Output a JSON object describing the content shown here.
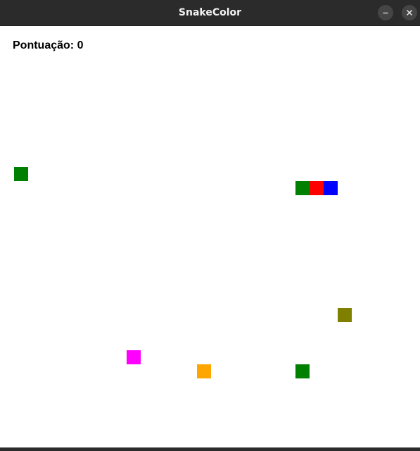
{
  "window": {
    "title": "SnakeColor",
    "minimize_label": "–",
    "close_label": "✕"
  },
  "game": {
    "score_label": "Pontuação:",
    "score_value": "0",
    "grid_cell": 20,
    "snake": [
      {
        "col": 21,
        "row": 10,
        "color": "#008000"
      },
      {
        "col": 22,
        "row": 10,
        "color": "#ff0000"
      },
      {
        "col": 23,
        "row": 10,
        "color": "#0000ff"
      }
    ],
    "food": [
      {
        "col": 1,
        "row": 9,
        "color": "#008000"
      },
      {
        "col": 24,
        "row": 19,
        "color": "#808000"
      },
      {
        "col": 9,
        "row": 22,
        "color": "#ff00ff"
      },
      {
        "col": 14,
        "row": 23,
        "color": "#ffa500"
      },
      {
        "col": 21,
        "row": 23,
        "color": "#008000"
      }
    ]
  }
}
